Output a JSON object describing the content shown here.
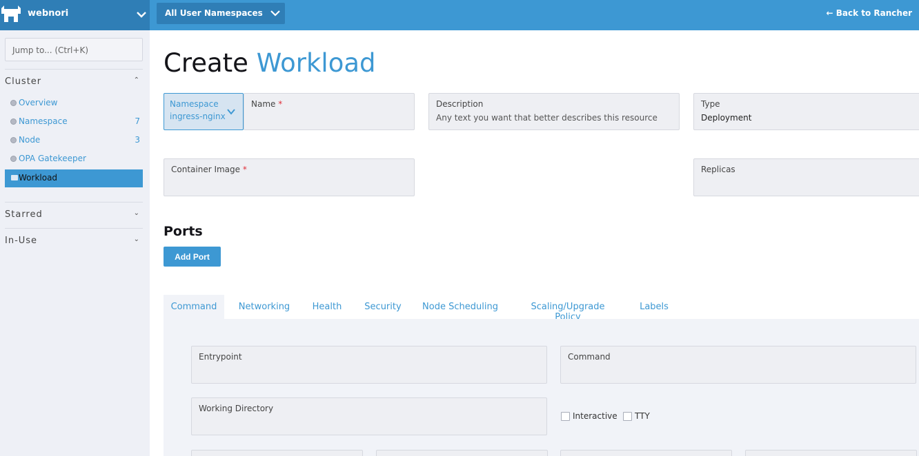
{
  "topbar": {
    "cluster_name": "webnori",
    "namespace_filter": "All User Namespaces",
    "back_link": "← Back to Rancher"
  },
  "sidebar": {
    "jump_placeholder": "Jump to... (Ctrl+K)",
    "groups": [
      {
        "title": "Cluster",
        "items": [
          {
            "label": "Overview",
            "count": ""
          },
          {
            "label": "Namespace",
            "count": "7"
          },
          {
            "label": "Node",
            "count": "3"
          },
          {
            "label": "OPA Gatekeeper",
            "count": ""
          },
          {
            "label": "Workload",
            "count": "",
            "active": true
          }
        ]
      },
      {
        "title": "Starred",
        "items": []
      },
      {
        "title": "In-Use",
        "items": []
      }
    ]
  },
  "page": {
    "title_prefix": "Create",
    "title_accent": "Workload"
  },
  "form": {
    "namespace": {
      "label": "Namespace",
      "value": "ingress-nginx"
    },
    "name": {
      "label": "Name",
      "required": "*",
      "value": ""
    },
    "description": {
      "label": "Description",
      "placeholder": "Any text you want that better describes this resource"
    },
    "type": {
      "label": "Type",
      "value": "Deployment"
    },
    "container_image": {
      "label": "Container Image",
      "required": "*",
      "value": ""
    },
    "replicas": {
      "label": "Replicas",
      "value": ""
    }
  },
  "ports": {
    "title": "Ports",
    "add_button": "Add Port"
  },
  "tabs": [
    {
      "label": "Command",
      "active": true
    },
    {
      "label": "Networking"
    },
    {
      "label": "Health"
    },
    {
      "label": "Security"
    },
    {
      "label": "Node Scheduling"
    },
    {
      "label": "Scaling/Upgrade Policy"
    },
    {
      "label": "Labels"
    }
  ],
  "command_panel": {
    "entrypoint": {
      "label": "Entrypoint",
      "value": ""
    },
    "command": {
      "label": "Command",
      "value": ""
    },
    "working_directory": {
      "label": "Working Directory",
      "value": ""
    },
    "interactive": {
      "label": "Interactive",
      "checked": false
    },
    "tty": {
      "label": "TTY",
      "checked": false
    }
  },
  "colors": {
    "accent": "#3d98d3",
    "topbar_dark": "#2f7eb6",
    "required": "#e0303a",
    "sidebar_bg": "#eef0f6"
  }
}
